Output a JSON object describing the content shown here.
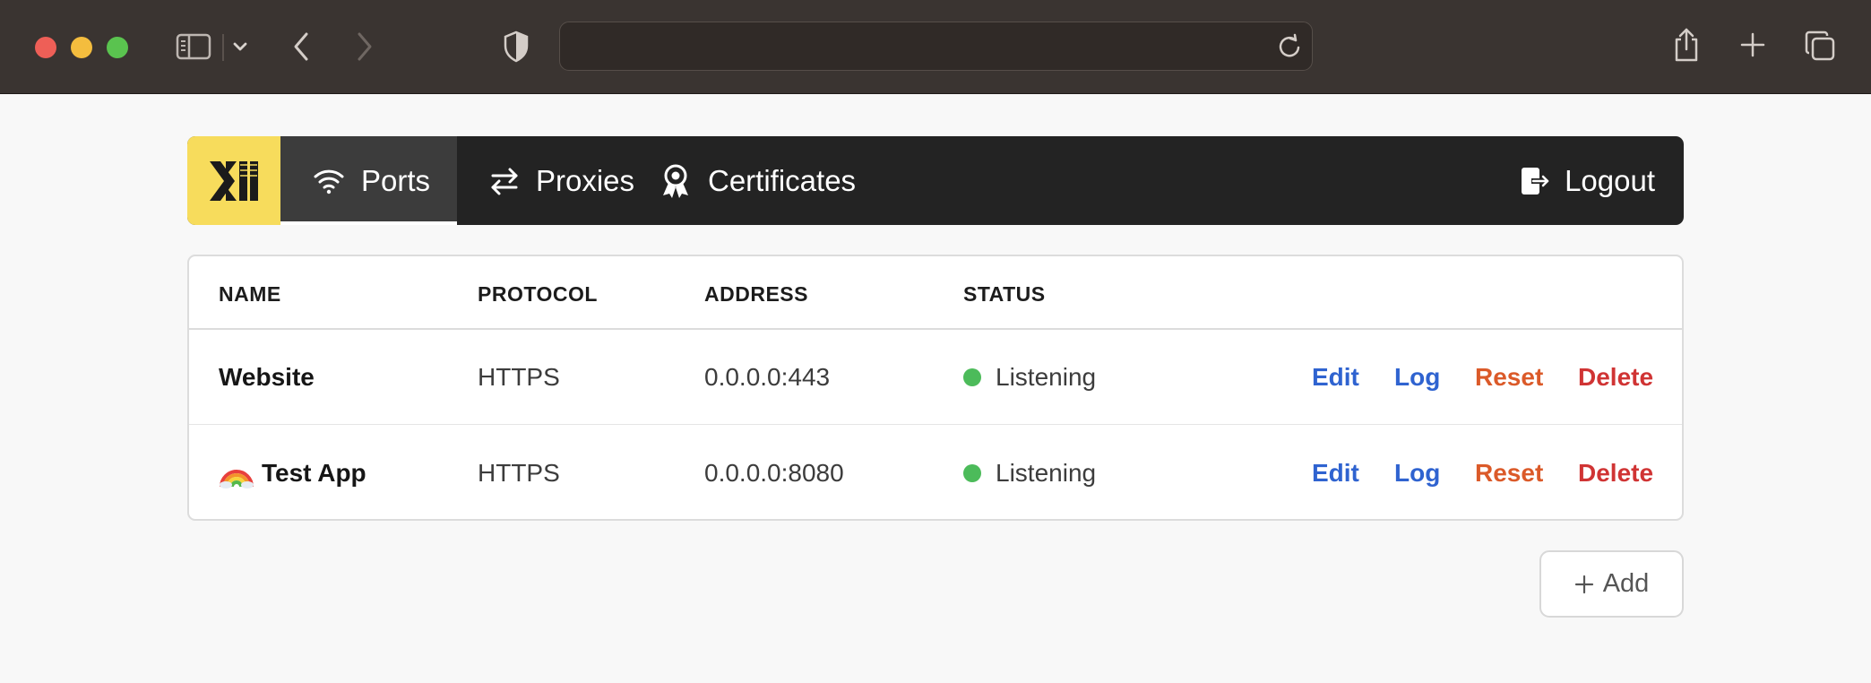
{
  "browser": {
    "address_value": "",
    "icons": {
      "sidebar": "sidebar-icon",
      "dropdown": "chevron-down-icon",
      "back": "chevron-left-icon",
      "forward": "chevron-right-icon",
      "privacy": "shield-icon",
      "reload": "reload-icon",
      "share": "share-icon",
      "new_tab": "plus-icon",
      "tabs": "tabs-overview-icon"
    }
  },
  "nav": {
    "logo_icon": "app-logo",
    "items": [
      {
        "label": "Ports",
        "icon": "wifi-icon",
        "active": true
      },
      {
        "label": "Proxies",
        "icon": "arrows-exchange-icon",
        "active": false
      },
      {
        "label": "Certificates",
        "icon": "award-ribbon-icon",
        "active": false
      }
    ],
    "logout_label": "Logout",
    "logout_icon": "logout-icon"
  },
  "table": {
    "headers": [
      "NAME",
      "PROTOCOL",
      "ADDRESS",
      "STATUS"
    ],
    "rows": [
      {
        "emoji": "",
        "name": "Website",
        "protocol": "HTTPS",
        "address": "0.0.0.0:443",
        "status": "Listening"
      },
      {
        "emoji": "rainbow",
        "name": "Test App",
        "protocol": "HTTPS",
        "address": "0.0.0.0:8080",
        "status": "Listening"
      }
    ],
    "actions": {
      "edit": "Edit",
      "log": "Log",
      "reset": "Reset",
      "delete": "Delete"
    }
  },
  "add_button": {
    "label": "Add",
    "icon": "plus-icon"
  },
  "colors": {
    "brand_yellow": "#f7dc5c",
    "nav_background": "#232323",
    "status_ok": "#4cbb5a",
    "link_blue": "#2f63d0",
    "reset_orange": "#db5a29",
    "delete_red": "#d03434"
  }
}
